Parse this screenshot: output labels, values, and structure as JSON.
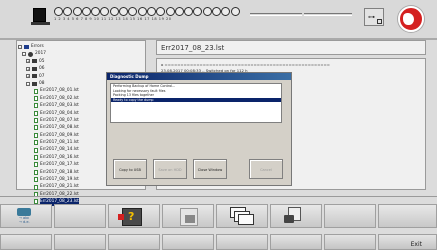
{
  "header": {
    "led_numbers": "1 2 3 4 5 6 7 8 9 10 11 12 13 14 15 16 17 18 19 20",
    "led_count": 20
  },
  "tree": {
    "root": "Errors",
    "year": "2017",
    "months": [
      "05",
      "06",
      "07",
      "08"
    ],
    "files": [
      "Err2017_08_01.lst",
      "Err2017_08_02.lst",
      "Err2017_08_03.lst",
      "Err2017_08_04.lst",
      "Err2017_08_07.lst",
      "Err2017_08_08.lst",
      "Err2017_08_09.lst",
      "Err2017_08_11.lst",
      "Err2017_08_14.lst",
      "Err2017_08_16.lst",
      "Err2017_08_17.lst",
      "Err2017_08_18.lst",
      "Err2017_08_19.lst",
      "Err2017_08_21.lst",
      "Err2017_08_22.lst",
      "Err2017_08_23.lst"
    ],
    "selected_file": "Err2017_08_23.lst"
  },
  "file_view": {
    "title": "Err2017_08_23.lst",
    "line1": "o  ====================================================",
    "line2": "23.08.2017 00:08:33 .. Switched on for 112 h"
  },
  "dialog": {
    "title": "Diagnostic Dump",
    "lines": [
      "Performing Backup of Home Control...",
      "Looking for necessary fault files",
      "Packing 13 files together",
      "Ready to copy the dump"
    ],
    "highlighted_index": 3,
    "buttons": {
      "copy": "Copy to USB",
      "save": "Save on HDD",
      "close": "Close Window",
      "cancel": "Cancel"
    }
  },
  "toolbar": {
    "icon1_text_a": "→ abc",
    "icon1_text_b": "→ d.e.",
    "exit_label": "Exit"
  }
}
